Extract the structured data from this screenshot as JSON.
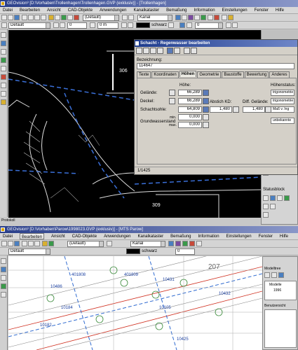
{
  "win1": {
    "title": "GEOvision³ [D:\\Vorhaben\\Trollenhagen\\Trollenhagen.GVP (exklusiv)] - [Trollenhagen]",
    "menu": [
      "Datei",
      "Bearbeiten",
      "Ansicht",
      "CAD-Objekte",
      "Anwendungen",
      "Kanalkataster",
      "Bemaßung",
      "Information",
      "Einstellungen",
      "Fenster",
      "Hilfe"
    ],
    "layer_combo": "Default",
    "style_combo": "(Default)",
    "kanal_combo": "Kanal",
    "color_label": "schwarz",
    "zero_value": "0",
    "zero_value2": "0",
    "zero_value3": "0 m",
    "map_labels": [
      "306",
      "309"
    ],
    "side_label": "Protokoll",
    "right_panel": {
      "title": "Statusblock"
    }
  },
  "dialog": {
    "title": "Schacht - Regenwasser bearbeiten",
    "bezeichnung_label": "Bezeichnung:",
    "bezeichnung_value": "114647",
    "tabs": [
      "Texte",
      "Koordinaten",
      "Höhen",
      "Geometrie",
      "Baustoffe",
      "Bewertung",
      "Anderes"
    ],
    "selected_tab": "Höhen",
    "hoehe_header": "Höhe:",
    "hoehenstatus_header": "Höhenstatus:",
    "rows": [
      {
        "label": "Gelände:",
        "value": "66,289",
        "status": "trigonometrie"
      },
      {
        "label": "Deckel:",
        "value": "66,289",
        "status": "trigonometrie"
      },
      {
        "label": "Schachtsohle:",
        "value": "64,809",
        "status": "Maß v. Ing"
      }
    ],
    "abstich_label": "Abstich KD:",
    "abstich_value": "1,480",
    "diff_label": "Diff. Gelände:",
    "diff_value": "1,480",
    "gw_label": "Grundwasserstand",
    "gw_min_label": "min.",
    "gw_min_value": "0,000",
    "gw_max_label": "max.",
    "gw_max_value": "0,000",
    "gw_status": "unbekannte",
    "status_bar": "1/1425"
  },
  "win2": {
    "title": "GEOvision³ [D:\\Vorhaben\\Parow\\1998023.GVP (exklusiv)] - [MTS Parow]",
    "menu": [
      "Datei",
      "Bearbeiten",
      "Ansicht",
      "CAD-Objekte",
      "Anwendungen",
      "Kanalkataster",
      "Bemaßung",
      "Information",
      "Einstellungen",
      "Fenster",
      "Hilfe"
    ],
    "active_menu": "Bearbeiten",
    "layer_combo": "Default",
    "style_combo": "(Default)",
    "kanal_combo": "Kanal",
    "color_label": "schwarz",
    "zero_value": "0",
    "map_labels": [
      "207",
      "401808",
      "401809",
      "10486",
      "10184",
      "10182",
      "10431",
      "10432",
      "10105",
      "10425"
    ],
    "right_panel": {
      "title": "Modelltree",
      "item1": "Modelle",
      "item2": "1996",
      "item3": "Benutzersicht"
    }
  },
  "colors": {
    "title_start": "#2a3f8a",
    "dialog_bg": "#d4d0c8",
    "cad_bg": "#000000"
  }
}
